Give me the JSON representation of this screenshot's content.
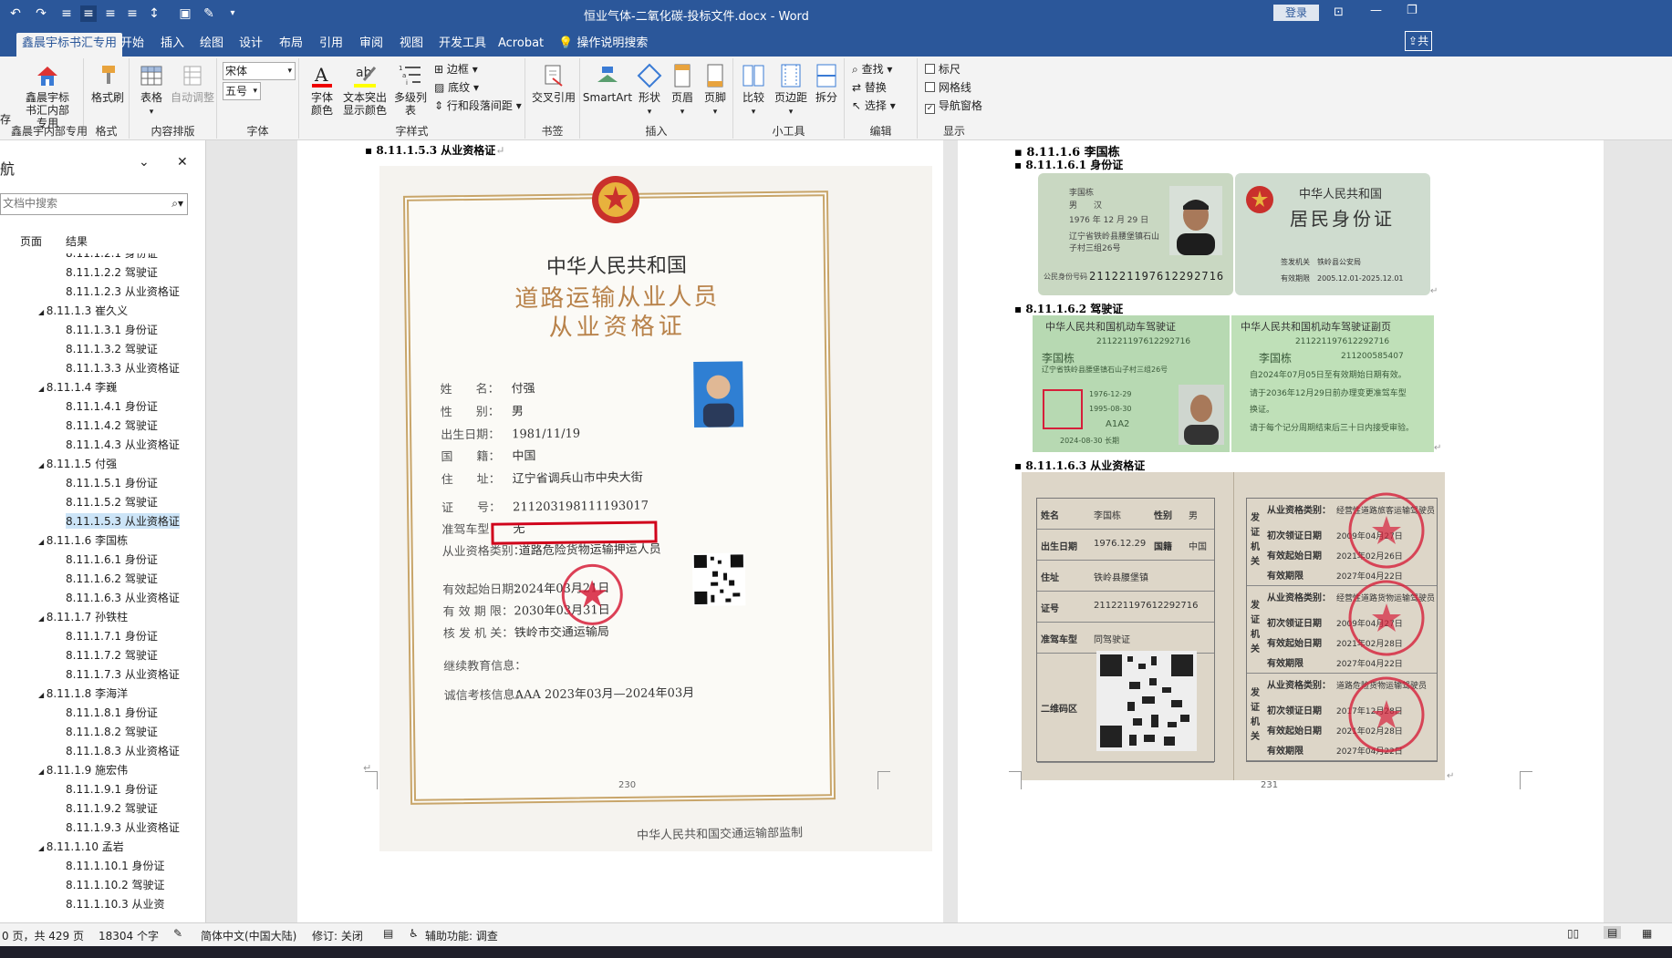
{
  "titlebar": {
    "doc_title": "恒业气体-二氧化碳-投标文件.docx  -  Word",
    "login_label": "登录"
  },
  "tabs": [
    "鑫晨宇标书汇专用",
    "开始",
    "插入",
    "绘图",
    "设计",
    "布局",
    "引用",
    "审阅",
    "视图",
    "开发工具",
    "Acrobat",
    "操作说明搜索"
  ],
  "tab_share": "共",
  "ribbon": {
    "g_xcy": {
      "btn": "鑫晨宇标书汇内部专用",
      "label": "鑫晨宇内部专用"
    },
    "g_format": {
      "btn": "格式刷",
      "label": "格式"
    },
    "g_content": {
      "btn1": "表格",
      "btn2": "自动调整",
      "label": "内容排版"
    },
    "g_font": {
      "font_name": "宋体",
      "font_size": "五号",
      "label": "字体"
    },
    "g_charstyle": {
      "btn1": "字体颜色",
      "btn2": "文本突出显示颜色",
      "btn3": "多级列表",
      "s1": "边框",
      "s2": "底纹",
      "s3": "行和段落间距",
      "label": "字样式"
    },
    "g_bookmark": {
      "btn": "交叉引用",
      "label": "书签"
    },
    "g_insert": {
      "btn1": "SmartArt",
      "btn2": "形状",
      "btn3": "页眉",
      "btn4": "页脚",
      "label": "插入"
    },
    "g_tools": {
      "btn1": "比较",
      "btn2": "页边距",
      "btn3": "拆分",
      "label": "小工具"
    },
    "g_edit": {
      "s1": "查找",
      "s2": "替换",
      "s3": "选择",
      "label": "编辑"
    },
    "g_show": {
      "c1": "标尺",
      "c2": "网格线",
      "c3": "导航窗格",
      "label": "显示"
    },
    "left_cut": "存"
  },
  "nav": {
    "title": "航",
    "search_placeholder": "文档中搜索",
    "tab_pages": "页面",
    "tab_results": "结果",
    "items": [
      {
        "t": "8.11.1.2.1 身份证",
        "lvl": 2
      },
      {
        "t": "8.11.1.2.2 驾驶证",
        "lvl": 2
      },
      {
        "t": "8.11.1.2.3 从业资格证",
        "lvl": 2
      },
      {
        "t": "8.11.1.3 崔久义",
        "lvl": 1
      },
      {
        "t": "8.11.1.3.1 身份证",
        "lvl": 2
      },
      {
        "t": "8.11.1.3.2 驾驶证",
        "lvl": 2
      },
      {
        "t": "8.11.1.3.3 从业资格证",
        "lvl": 2
      },
      {
        "t": "8.11.1.4 李巍",
        "lvl": 1
      },
      {
        "t": "8.11.1.4.1 身份证",
        "lvl": 2
      },
      {
        "t": "8.11.1.4.2 驾驶证",
        "lvl": 2
      },
      {
        "t": "8.11.1.4.3 从业资格证",
        "lvl": 2
      },
      {
        "t": "8.11.1.5 付强",
        "lvl": 1
      },
      {
        "t": "8.11.1.5.1 身份证",
        "lvl": 2
      },
      {
        "t": "8.11.1.5.2 驾驶证",
        "lvl": 2
      },
      {
        "t": "8.11.1.5.3 从业资格证",
        "lvl": 2,
        "sel": true
      },
      {
        "t": "8.11.1.6 李国栋",
        "lvl": 1
      },
      {
        "t": "8.11.1.6.1 身份证",
        "lvl": 2
      },
      {
        "t": "8.11.1.6.2 驾驶证",
        "lvl": 2
      },
      {
        "t": "8.11.1.6.3 从业资格证",
        "lvl": 2
      },
      {
        "t": "8.11.1.7 孙铁柱",
        "lvl": 1
      },
      {
        "t": "8.11.1.7.1 身份证",
        "lvl": 2
      },
      {
        "t": "8.11.1.7.2 驾驶证",
        "lvl": 2
      },
      {
        "t": "8.11.1.7.3 从业资格证",
        "lvl": 2
      },
      {
        "t": "8.11.1.8 李海洋",
        "lvl": 1
      },
      {
        "t": "8.11.1.8.1 身份证",
        "lvl": 2
      },
      {
        "t": "8.11.1.8.2 驾驶证",
        "lvl": 2
      },
      {
        "t": "8.11.1.8.3 从业资格证",
        "lvl": 2
      },
      {
        "t": "8.11.1.9 施宏伟",
        "lvl": 1
      },
      {
        "t": "8.11.1.9.1 身份证",
        "lvl": 2
      },
      {
        "t": "8.11.1.9.2 驾驶证",
        "lvl": 2
      },
      {
        "t": "8.11.1.9.3 从业资格证",
        "lvl": 2
      },
      {
        "t": "8.11.1.10 孟岩",
        "lvl": 1
      },
      {
        "t": "8.11.1.10.1 身份证",
        "lvl": 2
      },
      {
        "t": "8.11.1.10.2 驾驶证",
        "lvl": 2
      },
      {
        "t": "8.11.1.10.3 从业资",
        "lvl": 2
      }
    ]
  },
  "page_left": {
    "heading": "8.11.1.5.3 从业资格证",
    "cert": {
      "country": "中华人民共和国",
      "title1": "道路运输从业人员",
      "title2": "从业资格证",
      "fields": [
        {
          "k": "姓　　名：",
          "v": "付强"
        },
        {
          "k": "性　　别：",
          "v": "男"
        },
        {
          "k": "出生日期：",
          "v": "1981/11/19"
        },
        {
          "k": "国　　籍：",
          "v": "中国"
        },
        {
          "k": "住　　址：",
          "v": "辽宁省调兵山市中央大街"
        },
        {
          "k": "证　　号：",
          "v": "211203198111193017"
        },
        {
          "k": "准驾车型：",
          "v": "无"
        },
        {
          "k": "从业资格类别：",
          "v": "道路危险货物运输押运人员"
        },
        {
          "k": "有效起始日期：",
          "v": "2024年03月21日"
        },
        {
          "k": "有 效 期 限：",
          "v": "2030年03月31日"
        },
        {
          "k": "核 发 机 关：",
          "v": "铁岭市交通运输局"
        },
        {
          "k": "继续教育信息：",
          "v": ""
        },
        {
          "k": "诚信考核信息：",
          "v": "AAA  2023年03月—2024年03月"
        }
      ],
      "footer": "中华人民共和国交通运输部监制"
    },
    "page_no": "230"
  },
  "page_right": {
    "h1": "8.11.1.6 李国栋",
    "h2": "8.11.1.6.1 身份证",
    "h3": "8.11.1.6.2 驾驶证",
    "h4": "8.11.1.6.3 从业资格证",
    "id_front": {
      "name": "李国栋",
      "sex": "男",
      "nation": "汉",
      "birth": "1976 年 12 月 29 日",
      "addr1": "辽宁省铁岭县腰堡镇石山",
      "addr2": "子村三组26号",
      "id_label": "公民身份号码",
      "id_no": "211221197612292716"
    },
    "id_back": {
      "t1": "中华人民共和国",
      "t2": "居民身份证",
      "auth_k": "签发机关",
      "auth_v": "铁岭县公安局",
      "valid_k": "有效期限",
      "valid_v": "2005.12.01-2025.12.01"
    },
    "license": {
      "title_l": "中华人民共和国机动车驾驶证",
      "title_r": "中华人民共和国机动车驾驶证副页",
      "no": "211221197612292716",
      "name": "李国栋",
      "addr": "辽宁省铁岭县腰堡镇石山子村三组26号",
      "birth": "1976-12-29",
      "first": "1995-08-30",
      "cls": "A1A2",
      "valid": "2024-08-30 长期",
      "file": "211200585407",
      "r1": "自2024年07月05日至有效期始日期有效。",
      "r2": "请于2036年12月29日前办理变更准驾车型",
      "r3": "换证。",
      "r4": "请于每个记分周期结束后三十日内接受审验。"
    },
    "qual": {
      "rows": [
        {
          "k": "姓名",
          "v": "李国栋",
          "k2": "性别",
          "v2": "男"
        },
        {
          "k": "出生日期",
          "v": "1976.12.29",
          "k2": "国籍",
          "v2": "中国"
        },
        {
          "k": "住址",
          "v": "铁岭县腰堡镇"
        },
        {
          "k": "证号",
          "v": "211221197612292716"
        },
        {
          "k": "准驾车型",
          "v": "同驾驶证"
        },
        {
          "k": "二维码区",
          "v": ""
        }
      ],
      "side": "发证机关",
      "blocks": [
        {
          "cat_k": "从业资格类别：",
          "cat_v": "经营性道路旅客运输驾驶员",
          "first": "2009年04月27日",
          "start": "2021年02月26日",
          "end": "2027年04月22日"
        },
        {
          "cat_k": "从业资格类别：",
          "cat_v": "经营性道路货物运输驾驶员",
          "first": "2009年04月27日",
          "start": "2021年02月28日",
          "end": "2027年04月22日"
        },
        {
          "cat_k": "从业资格类别：",
          "cat_v": "道路危险货物运输驾驶员",
          "first": "2017年12月28日",
          "start": "2021年02月28日",
          "end": "2027年04月22日"
        }
      ],
      "first_k": "初次领证日期",
      "start_k": "有效起始日期",
      "end_k": "有效期限"
    },
    "page_no": "231"
  },
  "status": {
    "pages": "0 页，共 429 页",
    "words": "18304 个字",
    "lang": "简体中文(中国大陆)",
    "track": "修订: 关闭",
    "access": "辅助功能: 调查"
  },
  "colors": {
    "accent": "#2b579a",
    "ribbon": "#f3f3f3",
    "red_box": "#d0021b",
    "stamp": "#d61f3a"
  }
}
